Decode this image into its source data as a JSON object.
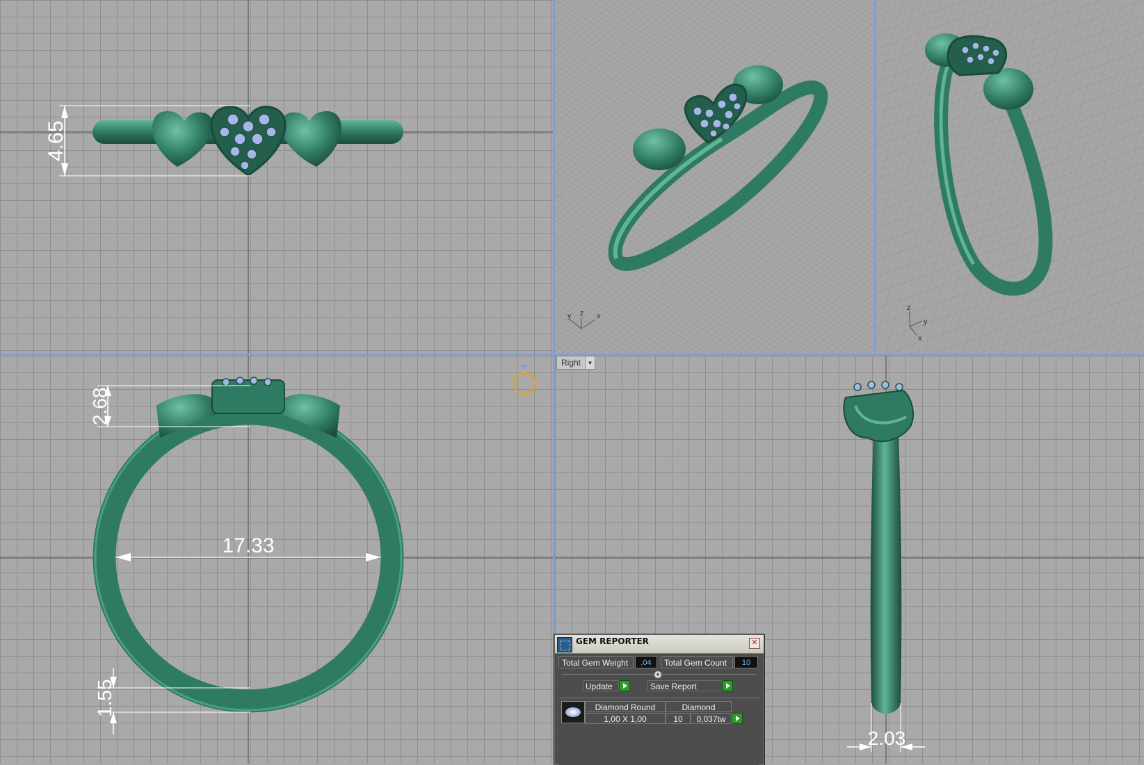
{
  "views": {
    "active_view_label": "Right",
    "axis_labels": {
      "y": "y",
      "z": "z",
      "x": "x"
    }
  },
  "dimensions": {
    "front_height": "4.65",
    "side_top_height": "2.68",
    "inner_diameter": "17.33",
    "band_thickness": "1.55",
    "band_width": "2.03"
  },
  "gem_reporter": {
    "title": "GEM REPORTER",
    "total_gem_weight_label": "Total Gem Weight",
    "total_gem_weight_value": ",04",
    "total_gem_count_label": "Total Gem Count",
    "total_gem_count_value": "10",
    "update_label": "Update",
    "save_report_label": "Save Report",
    "rows": [
      {
        "shape": "Diamond Round",
        "material": "Diamond",
        "size": "1,00 X 1,00",
        "count": "10",
        "weight": "0,037tw"
      }
    ]
  },
  "colors": {
    "metal": "#2f7a63",
    "metal_dark": "#1f5444",
    "metal_light": "#5fb596",
    "gem": "#a7b6e6",
    "viewport_bg": "#a9a9a9",
    "grid": "#8e8e8e",
    "divider": "#7f9fd6"
  }
}
